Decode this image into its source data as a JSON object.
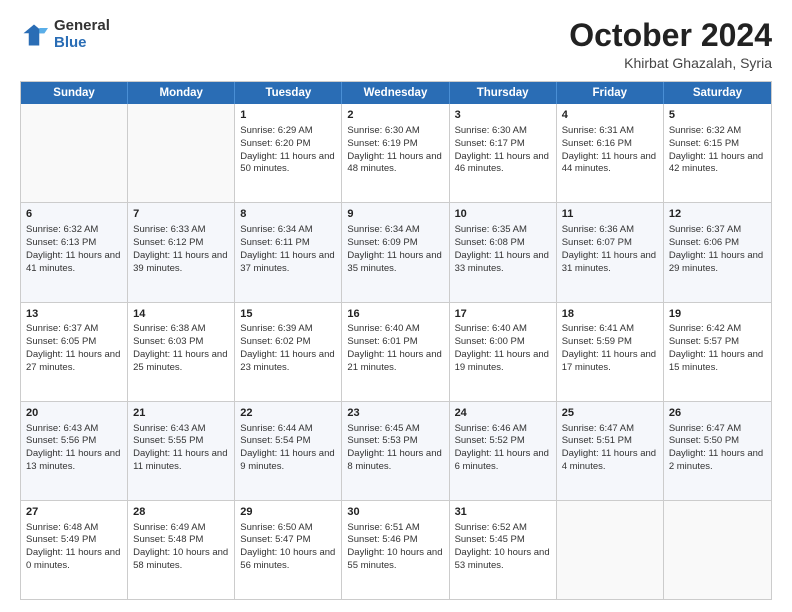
{
  "logo": {
    "general": "General",
    "blue": "Blue"
  },
  "title": "October 2024",
  "subtitle": "Khirbat Ghazalah, Syria",
  "headers": [
    "Sunday",
    "Monday",
    "Tuesday",
    "Wednesday",
    "Thursday",
    "Friday",
    "Saturday"
  ],
  "weeks": [
    [
      {
        "day": "",
        "sunrise": "",
        "sunset": "",
        "daylight": "",
        "empty": true
      },
      {
        "day": "",
        "sunrise": "",
        "sunset": "",
        "daylight": "",
        "empty": true
      },
      {
        "day": "1",
        "sunrise": "Sunrise: 6:29 AM",
        "sunset": "Sunset: 6:20 PM",
        "daylight": "Daylight: 11 hours and 50 minutes.",
        "empty": false
      },
      {
        "day": "2",
        "sunrise": "Sunrise: 6:30 AM",
        "sunset": "Sunset: 6:19 PM",
        "daylight": "Daylight: 11 hours and 48 minutes.",
        "empty": false
      },
      {
        "day": "3",
        "sunrise": "Sunrise: 6:30 AM",
        "sunset": "Sunset: 6:17 PM",
        "daylight": "Daylight: 11 hours and 46 minutes.",
        "empty": false
      },
      {
        "day": "4",
        "sunrise": "Sunrise: 6:31 AM",
        "sunset": "Sunset: 6:16 PM",
        "daylight": "Daylight: 11 hours and 44 minutes.",
        "empty": false
      },
      {
        "day": "5",
        "sunrise": "Sunrise: 6:32 AM",
        "sunset": "Sunset: 6:15 PM",
        "daylight": "Daylight: 11 hours and 42 minutes.",
        "empty": false
      }
    ],
    [
      {
        "day": "6",
        "sunrise": "Sunrise: 6:32 AM",
        "sunset": "Sunset: 6:13 PM",
        "daylight": "Daylight: 11 hours and 41 minutes.",
        "empty": false
      },
      {
        "day": "7",
        "sunrise": "Sunrise: 6:33 AM",
        "sunset": "Sunset: 6:12 PM",
        "daylight": "Daylight: 11 hours and 39 minutes.",
        "empty": false
      },
      {
        "day": "8",
        "sunrise": "Sunrise: 6:34 AM",
        "sunset": "Sunset: 6:11 PM",
        "daylight": "Daylight: 11 hours and 37 minutes.",
        "empty": false
      },
      {
        "day": "9",
        "sunrise": "Sunrise: 6:34 AM",
        "sunset": "Sunset: 6:09 PM",
        "daylight": "Daylight: 11 hours and 35 minutes.",
        "empty": false
      },
      {
        "day": "10",
        "sunrise": "Sunrise: 6:35 AM",
        "sunset": "Sunset: 6:08 PM",
        "daylight": "Daylight: 11 hours and 33 minutes.",
        "empty": false
      },
      {
        "day": "11",
        "sunrise": "Sunrise: 6:36 AM",
        "sunset": "Sunset: 6:07 PM",
        "daylight": "Daylight: 11 hours and 31 minutes.",
        "empty": false
      },
      {
        "day": "12",
        "sunrise": "Sunrise: 6:37 AM",
        "sunset": "Sunset: 6:06 PM",
        "daylight": "Daylight: 11 hours and 29 minutes.",
        "empty": false
      }
    ],
    [
      {
        "day": "13",
        "sunrise": "Sunrise: 6:37 AM",
        "sunset": "Sunset: 6:05 PM",
        "daylight": "Daylight: 11 hours and 27 minutes.",
        "empty": false
      },
      {
        "day": "14",
        "sunrise": "Sunrise: 6:38 AM",
        "sunset": "Sunset: 6:03 PM",
        "daylight": "Daylight: 11 hours and 25 minutes.",
        "empty": false
      },
      {
        "day": "15",
        "sunrise": "Sunrise: 6:39 AM",
        "sunset": "Sunset: 6:02 PM",
        "daylight": "Daylight: 11 hours and 23 minutes.",
        "empty": false
      },
      {
        "day": "16",
        "sunrise": "Sunrise: 6:40 AM",
        "sunset": "Sunset: 6:01 PM",
        "daylight": "Daylight: 11 hours and 21 minutes.",
        "empty": false
      },
      {
        "day": "17",
        "sunrise": "Sunrise: 6:40 AM",
        "sunset": "Sunset: 6:00 PM",
        "daylight": "Daylight: 11 hours and 19 minutes.",
        "empty": false
      },
      {
        "day": "18",
        "sunrise": "Sunrise: 6:41 AM",
        "sunset": "Sunset: 5:59 PM",
        "daylight": "Daylight: 11 hours and 17 minutes.",
        "empty": false
      },
      {
        "day": "19",
        "sunrise": "Sunrise: 6:42 AM",
        "sunset": "Sunset: 5:57 PM",
        "daylight": "Daylight: 11 hours and 15 minutes.",
        "empty": false
      }
    ],
    [
      {
        "day": "20",
        "sunrise": "Sunrise: 6:43 AM",
        "sunset": "Sunset: 5:56 PM",
        "daylight": "Daylight: 11 hours and 13 minutes.",
        "empty": false
      },
      {
        "day": "21",
        "sunrise": "Sunrise: 6:43 AM",
        "sunset": "Sunset: 5:55 PM",
        "daylight": "Daylight: 11 hours and 11 minutes.",
        "empty": false
      },
      {
        "day": "22",
        "sunrise": "Sunrise: 6:44 AM",
        "sunset": "Sunset: 5:54 PM",
        "daylight": "Daylight: 11 hours and 9 minutes.",
        "empty": false
      },
      {
        "day": "23",
        "sunrise": "Sunrise: 6:45 AM",
        "sunset": "Sunset: 5:53 PM",
        "daylight": "Daylight: 11 hours and 8 minutes.",
        "empty": false
      },
      {
        "day": "24",
        "sunrise": "Sunrise: 6:46 AM",
        "sunset": "Sunset: 5:52 PM",
        "daylight": "Daylight: 11 hours and 6 minutes.",
        "empty": false
      },
      {
        "day": "25",
        "sunrise": "Sunrise: 6:47 AM",
        "sunset": "Sunset: 5:51 PM",
        "daylight": "Daylight: 11 hours and 4 minutes.",
        "empty": false
      },
      {
        "day": "26",
        "sunrise": "Sunrise: 6:47 AM",
        "sunset": "Sunset: 5:50 PM",
        "daylight": "Daylight: 11 hours and 2 minutes.",
        "empty": false
      }
    ],
    [
      {
        "day": "27",
        "sunrise": "Sunrise: 6:48 AM",
        "sunset": "Sunset: 5:49 PM",
        "daylight": "Daylight: 11 hours and 0 minutes.",
        "empty": false
      },
      {
        "day": "28",
        "sunrise": "Sunrise: 6:49 AM",
        "sunset": "Sunset: 5:48 PM",
        "daylight": "Daylight: 10 hours and 58 minutes.",
        "empty": false
      },
      {
        "day": "29",
        "sunrise": "Sunrise: 6:50 AM",
        "sunset": "Sunset: 5:47 PM",
        "daylight": "Daylight: 10 hours and 56 minutes.",
        "empty": false
      },
      {
        "day": "30",
        "sunrise": "Sunrise: 6:51 AM",
        "sunset": "Sunset: 5:46 PM",
        "daylight": "Daylight: 10 hours and 55 minutes.",
        "empty": false
      },
      {
        "day": "31",
        "sunrise": "Sunrise: 6:52 AM",
        "sunset": "Sunset: 5:45 PM",
        "daylight": "Daylight: 10 hours and 53 minutes.",
        "empty": false
      },
      {
        "day": "",
        "sunrise": "",
        "sunset": "",
        "daylight": "",
        "empty": true
      },
      {
        "day": "",
        "sunrise": "",
        "sunset": "",
        "daylight": "",
        "empty": true
      }
    ]
  ]
}
